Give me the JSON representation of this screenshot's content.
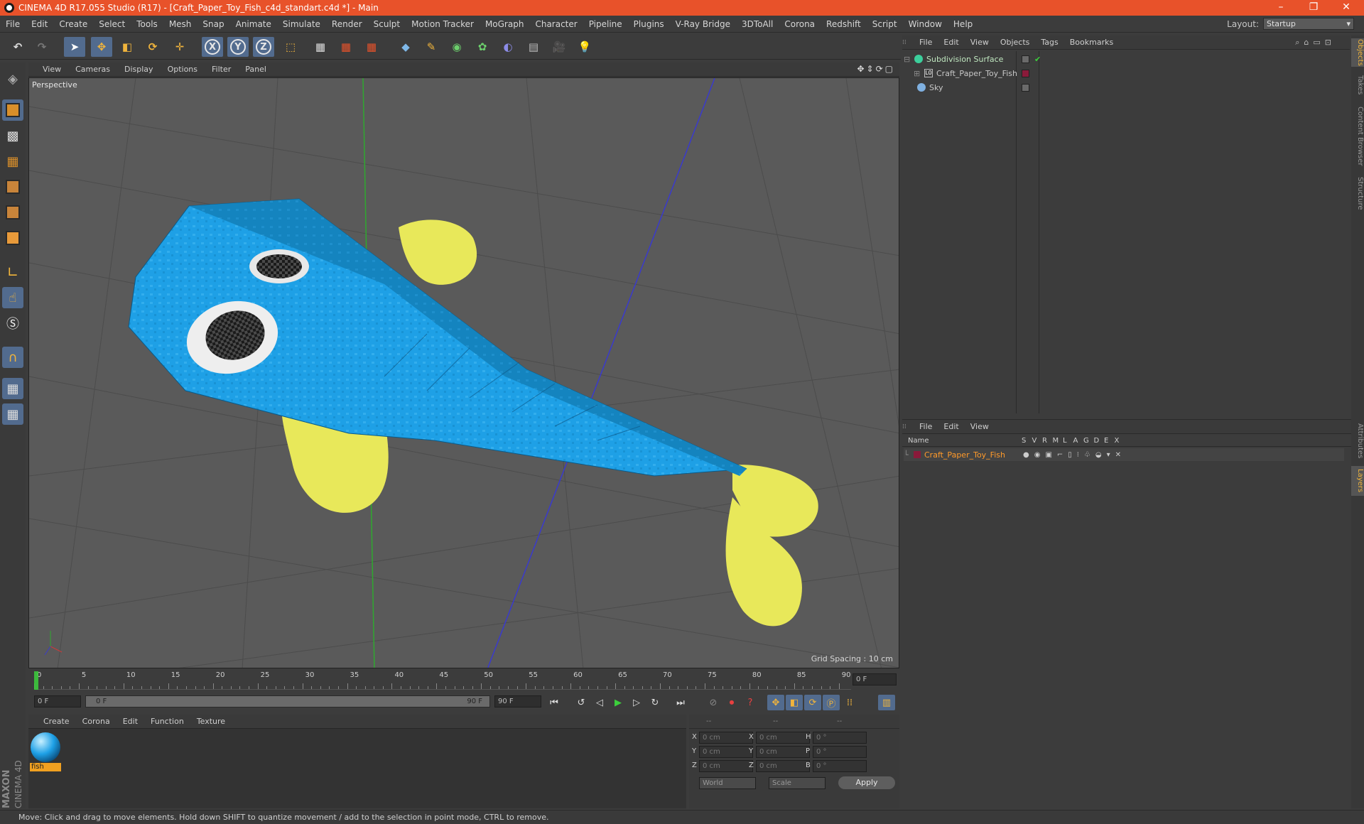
{
  "window": {
    "title": "CINEMA 4D R17.055 Studio (R17) - [Craft_Paper_Toy_Fish_c4d_standart.c4d *] - Main",
    "controls": [
      "–",
      "❐",
      "✕"
    ]
  },
  "menubar": {
    "items": [
      "File",
      "Edit",
      "Create",
      "Select",
      "Tools",
      "Mesh",
      "Snap",
      "Animate",
      "Simulate",
      "Render",
      "Sculpt",
      "Motion Tracker",
      "MoGraph",
      "Character",
      "Pipeline",
      "Plugins",
      "V-Ray Bridge",
      "3DToAll",
      "Corona",
      "Redshift",
      "Script",
      "Window",
      "Help"
    ],
    "layout_label": "Layout:",
    "layout_value": "Startup"
  },
  "toolbar": {
    "axis_x": "X",
    "axis_y": "Y",
    "axis_z": "Z"
  },
  "viewport": {
    "menu": [
      "View",
      "Cameras",
      "Display",
      "Options",
      "Filter",
      "Panel"
    ],
    "label": "Perspective",
    "grid_spacing": "Grid Spacing : 10 cm",
    "colors": {
      "background": "#5a5a5a",
      "grid": "#4c4c4c",
      "fish_body": "#1ea0e6",
      "fins": "#e8e85a",
      "y_axis": "#2fa82f",
      "z_axis": "#3a3acc"
    }
  },
  "timeline": {
    "ticks": [
      "0",
      "5",
      "10",
      "15",
      "20",
      "25",
      "30",
      "35",
      "40",
      "45",
      "50",
      "55",
      "60",
      "65",
      "70",
      "75",
      "80",
      "85",
      "90"
    ],
    "current_frame": "0 F"
  },
  "transport": {
    "start_field": "0 F",
    "range_start": "0 F",
    "range_end": "90 F",
    "end_field": "90 F"
  },
  "material_panel": {
    "menu": [
      "Create",
      "Corona",
      "Edit",
      "Function",
      "Texture"
    ],
    "material_name": "fish"
  },
  "coords": {
    "headers": [
      "--",
      "--",
      "--"
    ],
    "rows": [
      {
        "a": "X",
        "av": "0 cm",
        "b": "X",
        "bv": "0 cm",
        "c": "H",
        "cv": "0 °"
      },
      {
        "a": "Y",
        "av": "0 cm",
        "b": "Y",
        "bv": "0 cm",
        "c": "P",
        "cv": "0 °"
      },
      {
        "a": "Z",
        "av": "0 cm",
        "b": "Z",
        "bv": "0 cm",
        "c": "B",
        "cv": "0 °"
      }
    ],
    "mode1": "World",
    "mode2": "Scale",
    "apply": "Apply"
  },
  "object_manager": {
    "menu": [
      "File",
      "Edit",
      "View",
      "Objects",
      "Tags",
      "Bookmarks"
    ],
    "objects": [
      {
        "name": "Subdivision Surface",
        "color": "#bfe6bf"
      },
      {
        "name": "Craft_Paper_Toy_Fish",
        "color": "#cfcfcf"
      },
      {
        "name": "Sky",
        "color": "#cfcfcf"
      }
    ]
  },
  "layer_manager": {
    "menu": [
      "File",
      "Edit",
      "View"
    ],
    "columns": [
      "Name",
      "S",
      "V",
      "R",
      "M",
      "L",
      "A",
      "G",
      "D",
      "E",
      "X"
    ],
    "layers": [
      {
        "name": "Craft_Paper_Toy_Fish",
        "color": "#ff9a2a"
      }
    ]
  },
  "side_tabs": [
    "Objects",
    "Takes",
    "Content Browser",
    "Structure",
    "Attributes",
    "Layers"
  ],
  "logo": {
    "line1": "MAXON",
    "line2": "CINEMA 4D"
  },
  "status": "Move: Click and drag to move elements. Hold down SHIFT to quantize movement / add to the selection in point mode, CTRL to remove."
}
